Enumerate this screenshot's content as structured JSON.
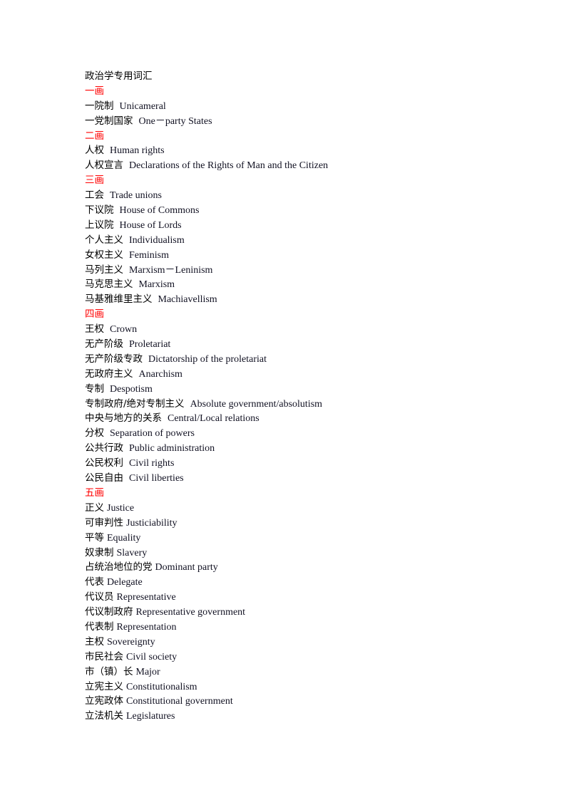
{
  "document": {
    "title": "政治学专用词汇",
    "heading_color": "#ff0000",
    "sections": [
      {
        "heading": "一画",
        "terms": [
          {
            "zh": "一院制",
            "en": "Unicameral"
          },
          {
            "zh": "一党制国家",
            "en": "One－party States"
          }
        ]
      },
      {
        "heading": "二画",
        "terms": [
          {
            "zh": "人权",
            "en": "Human rights"
          },
          {
            "zh": "人权宣言",
            "en": "Declarations of the Rights of Man and the Citizen"
          }
        ]
      },
      {
        "heading": "三画",
        "terms": [
          {
            "zh": "工会",
            "en": "Trade unions"
          },
          {
            "zh": "下议院",
            "en": "House of Commons"
          },
          {
            "zh": "上议院",
            "en": "House of Lords"
          },
          {
            "zh": "个人主义",
            "en": "Individualism"
          },
          {
            "zh": "女权主义",
            "en": "Feminism"
          },
          {
            "zh": "马列主义",
            "en": "Marxism－Leninism"
          },
          {
            "zh": "马克思主义",
            "en": "Marxism"
          },
          {
            "zh": "马基雅维里主义",
            "en": "Machiavellism"
          }
        ]
      },
      {
        "heading": "四画",
        "terms": [
          {
            "zh": "王权",
            "en": "Crown"
          },
          {
            "zh": "无产阶级",
            "en": "Proletariat"
          },
          {
            "zh": "无产阶级专政",
            "en": "Dictatorship of the proletariat"
          },
          {
            "zh": "无政府主义",
            "en": "Anarchism"
          },
          {
            "zh": "专制",
            "en": "Despotism"
          },
          {
            "zh": "专制政府/绝对专制主义",
            "en": "Absolute government/absolutism"
          },
          {
            "zh": "中央与地方的关系",
            "en": "Central/Local relations"
          },
          {
            "zh": "分权",
            "en": "Separation of powers"
          },
          {
            "zh": "公共行政",
            "en": "Public administration"
          },
          {
            "zh": "公民权利",
            "en": "Civil rights"
          },
          {
            "zh": "公民自由",
            "en": "Civil liberties"
          }
        ]
      },
      {
        "heading": "五画",
        "terms": [
          {
            "zh": "正义",
            "en": "Justice"
          },
          {
            "zh": "可审判性",
            "en": "Justiciability"
          },
          {
            "zh": "平等",
            "en": "Equality"
          },
          {
            "zh": "奴隶制",
            "en": "Slavery"
          },
          {
            "zh": "占统治地位的党",
            "en": "Dominant party"
          },
          {
            "zh": "代表",
            "en": "Delegate"
          },
          {
            "zh": "代议员",
            "en": "Representative"
          },
          {
            "zh": "代议制政府",
            "en": "Representative government"
          },
          {
            "zh": "代表制",
            "en": "Representation"
          },
          {
            "zh": "主权",
            "en": "Sovereignty"
          },
          {
            "zh": "市民社会",
            "en": "Civil society"
          },
          {
            "zh": "市（镇）长",
            "en": "Major"
          },
          {
            "zh": "立宪主义",
            "en": "Constitutionalism"
          },
          {
            "zh": "立宪政体",
            "en": "Constitutional government"
          },
          {
            "zh": "立法机关",
            "en": "Legislatures"
          }
        ]
      }
    ]
  }
}
